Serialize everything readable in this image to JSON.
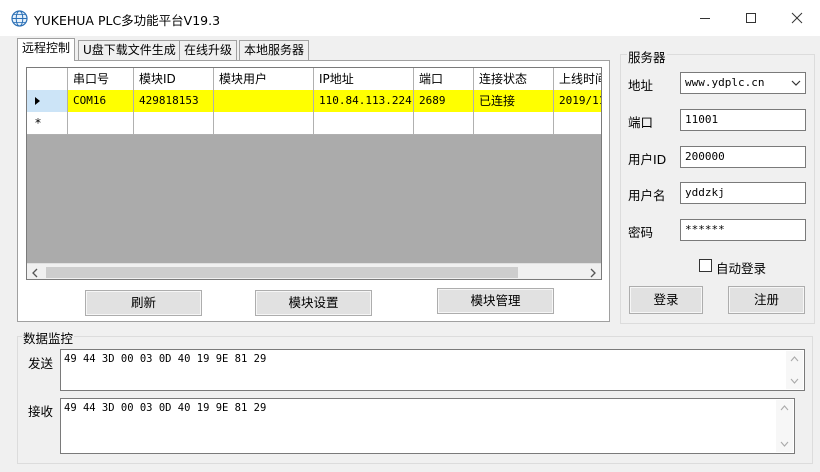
{
  "window": {
    "title": "YUKEHUA PLC多功能平台V19.3",
    "icons": {
      "app": "globe-icon",
      "minimize": "minimize-icon",
      "maximize": "maximize-icon",
      "close": "close-icon"
    }
  },
  "tabs": [
    {
      "label": "远程控制",
      "active": true
    },
    {
      "label": "U盘下载文件生成",
      "active": false
    },
    {
      "label": "在线升级",
      "active": false
    },
    {
      "label": "本地服务器",
      "active": false
    }
  ],
  "grid": {
    "columns": [
      "串口号",
      "模块ID",
      "模块用户",
      "IP地址",
      "端口",
      "连接状态",
      "上线时间"
    ],
    "rows": [
      [
        "COM16",
        "429818153",
        "",
        "110.84.113.224",
        "2689",
        "已连接",
        "2019/11/"
      ]
    ],
    "new_row_marker": "*",
    "selected_row_color": "#ffff00"
  },
  "actions": {
    "refresh": "刷新",
    "module_settings": "模块设置",
    "module_manage": "模块管理"
  },
  "server": {
    "group_title": "服务器",
    "address_label": "地址",
    "address_value": "www.ydplc.cn",
    "port_label": "端口",
    "port_value": "11001",
    "userid_label": "用户ID",
    "userid_value": "200000",
    "username_label": "用户名",
    "username_value": "yddzkj",
    "password_label": "密码",
    "password_value": "******",
    "auto_login_label": "自动登录",
    "auto_login_checked": false,
    "login_button": "登录",
    "register_button": "注册"
  },
  "monitor": {
    "title": "数据监控",
    "send_label": "发送",
    "send_value": "49 44 3D 00 03 0D 40 19 9E 81 29",
    "recv_label": "接收",
    "recv_value": "49 44 3D 00 03 0D 40 19 9E 81 29"
  }
}
